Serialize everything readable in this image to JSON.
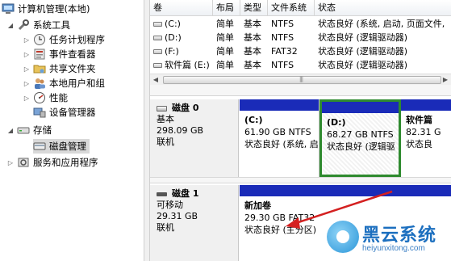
{
  "tree": {
    "items": [
      {
        "label": "计算机管理(本地)",
        "icon": "computer-icon"
      },
      {
        "label": "系统工具",
        "icon": "tools-icon"
      },
      {
        "label": "任务计划程序",
        "icon": "clock-icon"
      },
      {
        "label": "事件查看器",
        "icon": "event-viewer-icon"
      },
      {
        "label": "共享文件夹",
        "icon": "shared-folder-icon"
      },
      {
        "label": "本地用户和组",
        "icon": "users-icon"
      },
      {
        "label": "性能",
        "icon": "performance-icon"
      },
      {
        "label": "设备管理器",
        "icon": "device-manager-icon"
      },
      {
        "label": "存储",
        "icon": "storage-icon"
      },
      {
        "label": "磁盘管理",
        "icon": "disk-management-icon"
      },
      {
        "label": "服务和应用程序",
        "icon": "services-icon"
      }
    ]
  },
  "volume_list": {
    "columns": [
      "卷",
      "布局",
      "类型",
      "文件系统",
      "状态"
    ],
    "rows": [
      {
        "volume": "(C:)",
        "layout": "简单",
        "type": "基本",
        "fs": "NTFS",
        "status": "状态良好 (系统, 启动, 页面文件,"
      },
      {
        "volume": "(D:)",
        "layout": "简单",
        "type": "基本",
        "fs": "NTFS",
        "status": "状态良好 (逻辑驱动器)"
      },
      {
        "volume": "(F:)",
        "layout": "简单",
        "type": "基本",
        "fs": "FAT32",
        "status": "状态良好 (逻辑驱动器)"
      },
      {
        "volume": "软件篇 (E:)",
        "layout": "简单",
        "type": "基本",
        "fs": "NTFS",
        "status": "状态良好 (逻辑驱动器)"
      }
    ]
  },
  "disks": [
    {
      "name": "磁盘 0",
      "kind": "基本",
      "size": "298.09 GB",
      "state": "联机",
      "partitions": [
        {
          "name": "(C:)",
          "size": "61.90 GB NTFS",
          "status": "状态良好 (系统, 启"
        },
        {
          "name": "(D:)",
          "size": "68.27 GB NTFS",
          "status": "状态良好 (逻辑驱"
        },
        {
          "name": "软件篇",
          "size": "82.31 G",
          "status": "状态良"
        }
      ]
    },
    {
      "name": "磁盘 1",
      "kind": "可移动",
      "size": "29.31 GB",
      "state": "联机",
      "partitions": [
        {
          "name": "新加卷",
          "size": "29.30 GB FAT32",
          "status": "状态良好 (主分区)"
        }
      ]
    }
  ],
  "watermark": {
    "name": "黑云系统",
    "url": "heiyunxitong.com"
  },
  "colors": {
    "partition_bar": "#1a2bb8",
    "selected_border": "#2f8a2f",
    "arrow": "#d42020"
  }
}
